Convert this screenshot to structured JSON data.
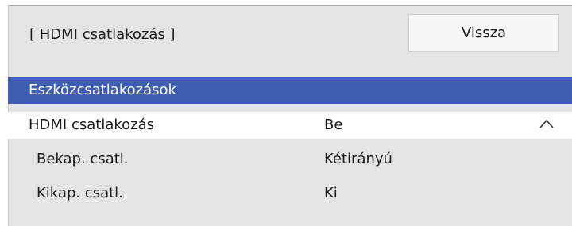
{
  "header": {
    "title": "[ HDMI csatlakozás ]",
    "back_label": "Vissza"
  },
  "section": {
    "title": "Eszközcsatlakozások"
  },
  "rows": [
    {
      "label": "HDMI csatlakozás",
      "value": "Be",
      "icon": "chevron-up-icon"
    },
    {
      "label": "Bekap. csatl.",
      "value": "Kétirányú"
    },
    {
      "label": "Kikap. csatl.",
      "value": "Ki"
    }
  ],
  "colors": {
    "section_bar": "#3f5eb1",
    "panel_background": "#e4e4e4",
    "selected_row": "#ffffff"
  }
}
